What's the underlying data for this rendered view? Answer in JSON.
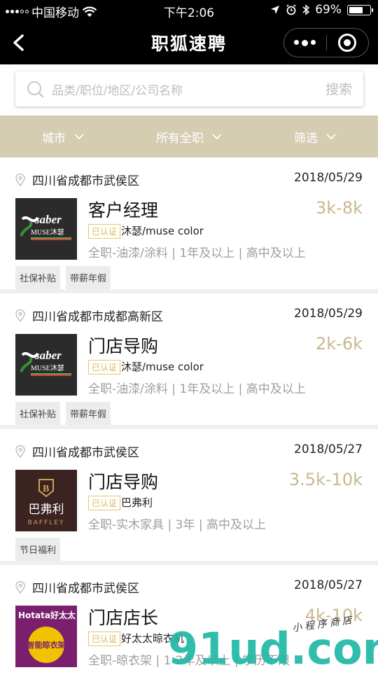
{
  "status": {
    "carrier": "中国移动",
    "time": "下午2:06",
    "battery": "69%"
  },
  "nav": {
    "title": "职狐速聘"
  },
  "search": {
    "placeholder": "品类/职位/地区/公司名称",
    "button": "搜索"
  },
  "filters": [
    {
      "label": "城市"
    },
    {
      "label": "所有全职"
    },
    {
      "label": "筛选"
    }
  ],
  "verified_label": "已认证",
  "jobs": [
    {
      "location": "四川省成都市武侯区",
      "date": "2018/05/29",
      "title": "客户经理",
      "salary": "3k-8k",
      "company": "沐瑟/muse color",
      "desc": "全职-油漆/涂料 | 1年及以上 | 高中及以上",
      "tags": [
        "社保补贴",
        "带薪年假"
      ],
      "logo": {
        "name": "saber",
        "sub": "MUSE沐瑟"
      }
    },
    {
      "location": "四川省成都市成都高新区",
      "date": "2018/05/29",
      "title": "门店导购",
      "salary": "2k-6k",
      "company": "沐瑟/muse color",
      "desc": "全职-油漆/涂料 | 1年及以上 | 高中及以上",
      "tags": [
        "社保补贴",
        "带薪年假"
      ],
      "logo": {
        "name": "saber",
        "sub": "MUSE沐瑟"
      }
    },
    {
      "location": "四川省成都市武侯区",
      "date": "2018/05/27",
      "title": "门店导购",
      "salary": "3.5k-10k",
      "company": "巴弗利",
      "desc": "全职-实木家具 | 3年 | 高中及以上",
      "tags": [
        "节日福利"
      ],
      "logo": {
        "name": "巴弗利",
        "sub": "BAFFLEY"
      }
    },
    {
      "location": "四川省成都市武侯区",
      "date": "2018/05/27",
      "title": "门店店长",
      "salary": "4k-10k",
      "company": "好太太晾衣机",
      "desc": "全职-晾衣架 | 1-2年及以上 | 学历不限",
      "tags": [],
      "logo": {
        "name": "Hotata好太太",
        "sub": "智能晾衣架"
      }
    }
  ],
  "watermark": {
    "text": "91ud.com",
    "sub": "小程序商店"
  }
}
